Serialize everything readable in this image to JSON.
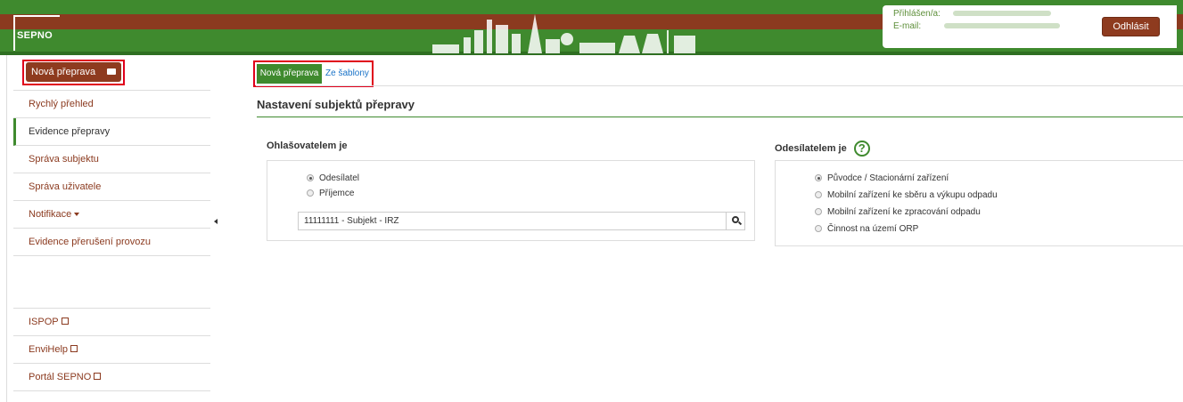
{
  "header": {
    "logo": "SEPNO",
    "user": {
      "logged_label": "Přihlášen/a:",
      "email_label": "E-mail:"
    },
    "logout_label": "Odhlásit"
  },
  "sidebar": {
    "new_transport_label": "Nová přeprava",
    "items": [
      {
        "label": "Rychlý přehled"
      },
      {
        "label": "Evidence přepravy"
      },
      {
        "label": "Správa subjektu"
      },
      {
        "label": "Správa uživatele"
      },
      {
        "label": "Notifikace"
      },
      {
        "label": "Evidence přerušení provozu"
      }
    ],
    "links": [
      {
        "label": "ISPOP"
      },
      {
        "label": "EnviHelp"
      },
      {
        "label": "Portál SEPNO"
      }
    ]
  },
  "main": {
    "tabs": [
      {
        "label": "Nová přeprava"
      },
      {
        "label": "Ze šablony"
      }
    ],
    "section_title": "Nastavení subjektů přepravy",
    "reporter": {
      "title": "Ohlašovatelem je",
      "options": [
        "Odesílatel",
        "Příjemce"
      ],
      "selected": "Odesílatel",
      "subject_value": "11111111 - Subjekt - IRZ"
    },
    "sender": {
      "title": "Odesílatelem je",
      "help": "?",
      "options": [
        "Původce / Stacionární zařízení",
        "Mobilní zařízení ke sběru a výkupu odpadu",
        "Mobilní zařízení ke zpracování odpadu",
        "Činnost na území ORP"
      ],
      "selected": "Původce / Stacionární zařízení"
    }
  },
  "colors": {
    "brand_green": "#3f8a2e",
    "brand_brown": "#8e3b1f",
    "highlight_red": "#e0001b"
  }
}
